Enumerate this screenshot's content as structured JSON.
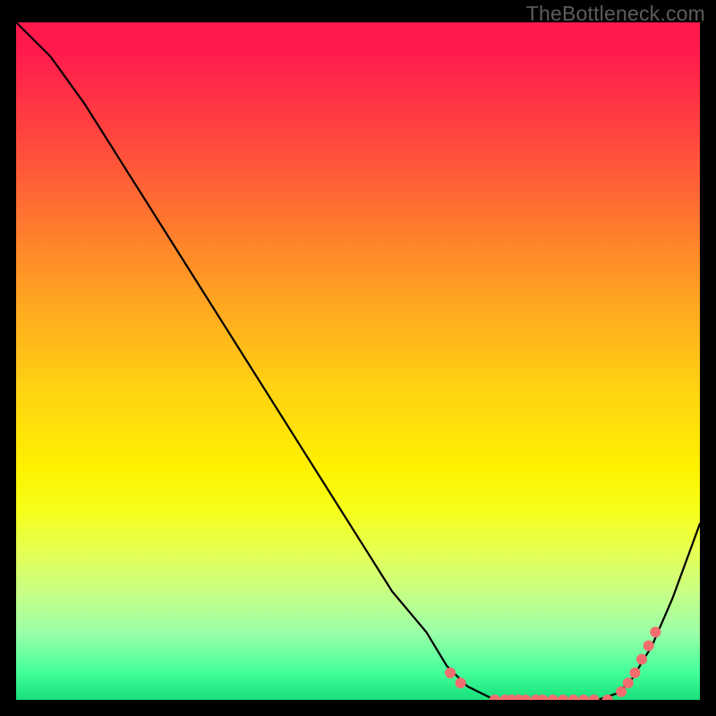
{
  "attribution": "TheBottleneck.com",
  "colors": {
    "background": "#000000",
    "curve_stroke": "#000000",
    "marker_fill": "#f26d6d",
    "marker_stroke": "#f26d6d"
  },
  "chart_data": {
    "type": "line",
    "title": "",
    "xlabel": "",
    "ylabel": "",
    "xlim": [
      0,
      100
    ],
    "ylim": [
      0,
      100
    ],
    "grid": false,
    "series": [
      {
        "name": "bottleneck-curve",
        "x": [
          0,
          5,
          10,
          15,
          20,
          25,
          30,
          35,
          40,
          45,
          50,
          55,
          60,
          63,
          66,
          70,
          73,
          76,
          79,
          82,
          85,
          88,
          90,
          93,
          96,
          100
        ],
        "y": [
          100,
          95,
          88,
          80,
          72,
          64,
          56,
          48,
          40,
          32,
          24,
          16,
          10,
          5,
          2,
          0,
          0,
          0,
          0,
          0,
          0,
          1,
          3,
          8,
          15,
          26
        ]
      }
    ],
    "markers": {
      "name": "highlight-dots",
      "x": [
        63.5,
        65.0,
        70.0,
        71.5,
        72.5,
        73.5,
        74.5,
        76.0,
        77.0,
        78.5,
        80.0,
        81.5,
        83.0,
        84.5,
        86.5,
        88.5,
        89.5,
        90.5,
        91.5,
        92.5,
        93.5
      ],
      "y": [
        4.0,
        2.5,
        0.0,
        0.0,
        0.0,
        0.0,
        0.0,
        0.0,
        0.0,
        0.0,
        0.0,
        0.0,
        0.0,
        0.0,
        0.0,
        1.2,
        2.5,
        4.0,
        6.0,
        8.0,
        10.0
      ]
    }
  }
}
